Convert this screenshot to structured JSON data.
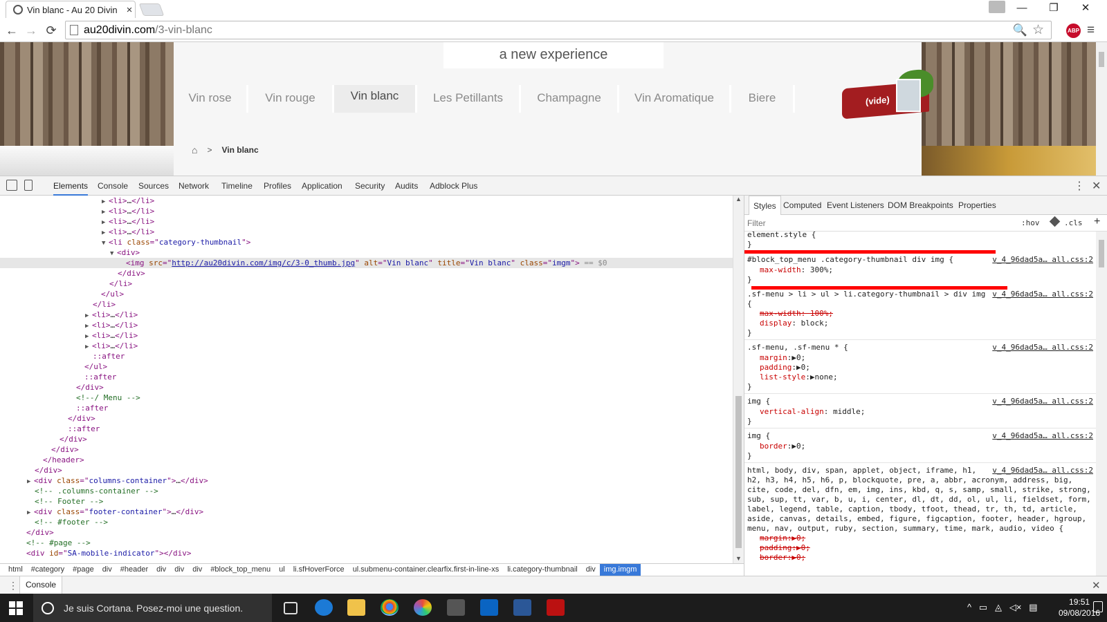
{
  "browser": {
    "tab_title": "Vin blanc - Au 20 Divin",
    "close_tab": "×",
    "win_min": "—",
    "win_restore": "❐",
    "win_close": "✕",
    "back": "←",
    "forward": "→",
    "reload": "⟳",
    "url_host": "au20divin.com",
    "url_path": "/3-vin-blanc",
    "zoom_icon": "🔍",
    "star_icon": "☆",
    "abp": "ABP",
    "menu": "≡"
  },
  "site": {
    "logo_text": "a new experience",
    "nav": [
      "Vin rose",
      "Vin rouge",
      "Vin blanc",
      "Les Petillants",
      "Champagne",
      "Vin Aromatique",
      "Biere"
    ],
    "active_nav": "Vin blanc",
    "cart_label": "(vide)",
    "breadcrumb_sep": ">",
    "breadcrumb_current": "Vin blanc",
    "home_icon": "⌂"
  },
  "devtools": {
    "tabs": [
      "Elements",
      "Console",
      "Sources",
      "Network",
      "Timeline",
      "Profiles",
      "Application",
      "Security",
      "Audits",
      "Adblock Plus"
    ],
    "active_tab": "Elements",
    "more": "⋮",
    "close": "✕",
    "dom": {
      "img_src": "http://au20divin.com/img/c/3-0_thumb.jpg",
      "img_alt": "Vin blanc",
      "img_title": "Vin blanc",
      "img_class": "imgm",
      "li_class": "category-thumbnail",
      "columns_class": "columns-container",
      "columns_comment": "<!-- .columns-container -->",
      "footer_comment": "<!-- Footer -->",
      "footer_class": "footer-container",
      "footer_end_comment": "<!-- #footer -->",
      "page_comment": "<!-- #page -->",
      "menu_comment": "<!--/ Menu -->",
      "mobile_id": "SA-mobile-indicator",
      "after": "::after",
      "sel_marker": "== $0"
    },
    "breadcrumbs": [
      "html",
      "#category",
      "#page",
      "div",
      "#header",
      "div",
      "div",
      "div",
      "#block_top_menu",
      "ul",
      "li.sfHoverForce",
      "ul.submenu-container.clearfix.first-in-line-xs",
      "li.category-thumbnail",
      "div",
      "img.imgm"
    ],
    "breadcrumb_selected": "img.imgm",
    "sidebar_tabs": [
      "Styles",
      "Computed",
      "Event Listeners",
      "DOM Breakpoints",
      "Properties"
    ],
    "active_sidebar_tab": "Styles",
    "filter_placeholder": "Filter",
    "hov": ":hov",
    "cls": ".cls",
    "plus": "+",
    "styles": {
      "element_style": "element.style {",
      "close": "}",
      "rule1_selector": "#block_top_menu .category-thumbnail div img {",
      "rule1_source": "v_4_96dad5a… all.css:2",
      "rule1_prop": "max-width",
      "rule1_val": "300%;",
      "rule2_selector": ".sf-menu > li > ul > li.category-thumbnail > div img",
      "rule2_source": "v_4_96dad5a… all.css:2",
      "rule2_open": "{",
      "rule2_prop1": "max-width: 100%;",
      "rule2_prop2": "display",
      "rule2_val2": "block;",
      "rule3_selector": ".sf-menu, .sf-menu * {",
      "rule3_source": "v_4_96dad5a… all.css:2",
      "rule3_margin": "margin",
      "rule3_margin_val": "▶0;",
      "rule3_padding": "padding",
      "rule3_padding_val": "▶0;",
      "rule3_list": "list-style",
      "rule3_list_val": "▶none;",
      "rule4_selector": "img {",
      "rule4_source": "v_4_96dad5a… all.css:2",
      "rule4_prop": "vertical-align",
      "rule4_val": "middle;",
      "rule5_selector": "img {",
      "rule5_source": "v_4_96dad5a… all.css:2",
      "rule5_prop": "border",
      "rule5_val": "▶0;",
      "reset_source": "v_4_96dad5a… all.css:2",
      "reset_lines": [
        "html, body, div, span, applet, object, iframe, h1,",
        "h2, h3, h4, h5, h6, p, blockquote, pre, a, abbr, acronym, address, big,",
        "cite, code, del, dfn, em, img, ins, kbd, q, s, samp, small, strike, strong,",
        "sub, sup, tt, var, b, u, i, center, dl, dt, dd, ol, ul, li, fieldset, form,",
        "label, legend, table, caption, tbody, tfoot, thead, tr, th, td, article,",
        "aside, canvas, details, embed, figure, figcaption, footer, header, hgroup,",
        "menu, nav, output, ruby, section, summary, time, mark, audio, video {"
      ],
      "reset_margin": "margin:▶0;",
      "reset_padding": "padding:▶0;",
      "reset_border": "border:▶0;"
    },
    "drawer_label": "Console",
    "drawer_dots": "⋮",
    "drawer_close": "✕"
  },
  "taskbar": {
    "search_text": "Je suis Cortana. Posez-moi une question.",
    "tray_icons": "^   ▭   ◬   ◁×   ▤",
    "time": "19:51",
    "date": "09/08/2016"
  },
  "colors": {
    "accent_blue": "#3879d9",
    "cart_red": "#a31d20",
    "annotation_red": "#ff0000",
    "abp_red": "#c70d2c"
  }
}
